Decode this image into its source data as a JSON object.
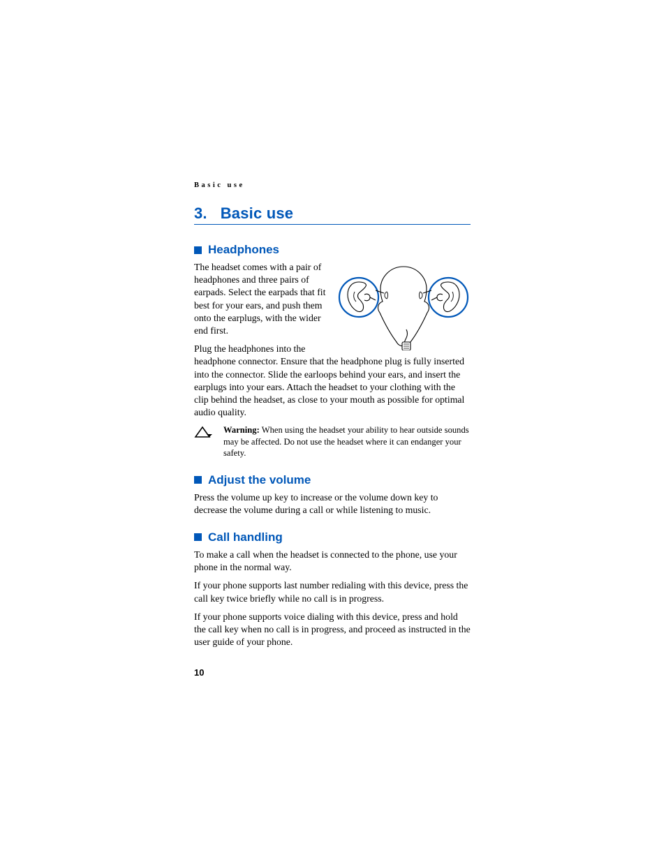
{
  "runningHeader": "Basic use",
  "chapter": {
    "number": "3.",
    "title": "Basic use"
  },
  "sections": {
    "headphones": {
      "heading": "Headphones",
      "para1": "The headset comes with a pair of headphones and three pairs of earpads. Select the earpads that fit best for your ears, and push them onto the earplugs, with the wider end first.",
      "para2": "Plug the headphones into the headphone connector. Ensure that the headphone plug is fully inserted into the connector. Slide the earloops behind your ears, and insert the earplugs into your ears. Attach the headset to your clothing with the clip behind the headset, as close to your mouth as possible for optimal audio quality.",
      "warning": {
        "label": "Warning:",
        "text": " When using the headset your ability to hear outside sounds may be affected. Do not use the headset where it can endanger your safety."
      }
    },
    "adjustVolume": {
      "heading": "Adjust the volume",
      "para1": "Press the volume up key to increase or the volume down key to decrease the volume during a call or while listening to music."
    },
    "callHandling": {
      "heading": "Call handling",
      "para1": "To make a call when the headset is connected to the phone, use your phone in the normal way.",
      "para2": "If your phone supports last number redialing with this device, press the call key twice briefly while no call is in progress.",
      "para3": "If your phone supports voice dialing with this device, press and hold the call key when no call is in progress, and proceed as instructed in the user guide of your phone."
    }
  },
  "pageNumber": "10"
}
